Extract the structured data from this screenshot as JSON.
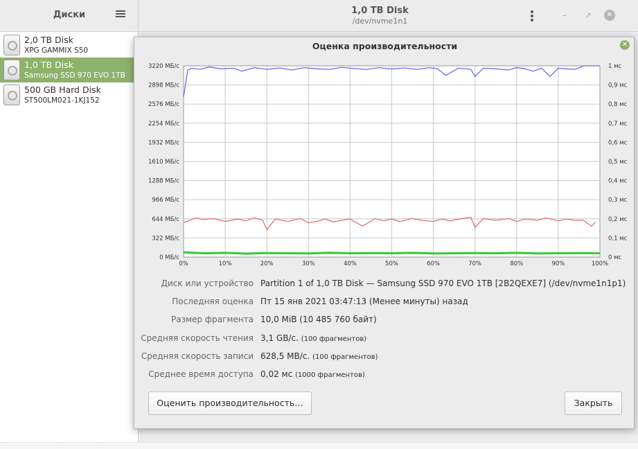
{
  "sidebar": {
    "title": "Диски",
    "items": [
      {
        "name": "2,0 TB Disk",
        "model": "XPG GAMMIX S50"
      },
      {
        "name": "1,0 TB Disk",
        "model": "Samsung SSD 970 EVO 1TB"
      },
      {
        "name": "500 GB Hard Disk",
        "model": "ST500LM021-1KJ152"
      }
    ],
    "selected_index": 1
  },
  "header": {
    "title": "1,0 TB Disk",
    "subtitle": "/dev/nvme1n1",
    "minimize_glyph": "–",
    "maximize_glyph": "↗",
    "close_glyph": "✕"
  },
  "dialog": {
    "title": "Оценка производительности",
    "close_glyph": "✕",
    "info": [
      {
        "label": "Диск или устройство",
        "value": "Partition 1 of 1,0 TB Disk — Samsung SSD 970 EVO 1TB [2B2QEXE7] (/dev/nvme1n1p1)",
        "extra": ""
      },
      {
        "label": "Последняя оценка",
        "value": "Пт 15 янв 2021 03:47:13 (Менее минуты) назад",
        "extra": ""
      },
      {
        "label": "Размер фрагмента",
        "value": "10,0 MiB (10 485 760 байт)",
        "extra": ""
      },
      {
        "label": "Средняя скорость чтения",
        "value": "3,1 GB/с.",
        "extra": "(100 фрагментов)"
      },
      {
        "label": "Средняя скорость записи",
        "value": "628,5 MB/с.",
        "extra": "(100 фрагментов)"
      },
      {
        "label": "Среднее время доступа",
        "value": "0,02 мс",
        "extra": "(1000 фрагментов)"
      }
    ],
    "buttons": {
      "benchmark": "Оценить производительность…",
      "close": "Закрыть"
    }
  },
  "chart_data": {
    "type": "line",
    "left_axis_ticks": [
      "3220 МБ/с",
      "2898 МБ/с",
      "2576 МБ/с",
      "2254 МБ/с",
      "1932 МБ/с",
      "1610 МБ/с",
      "1288 МБ/с",
      "966 МБ/с",
      "644 МБ/с",
      "322 МБ/с",
      "0 МБ/с"
    ],
    "right_axis_ticks": [
      "1 мс",
      "0,9 мс",
      "0,8 мс",
      "0,7 мс",
      "0,6 мс",
      "0,5 мс",
      "0,4 мс",
      "0,3 мс",
      "0,2 мс",
      "0,1 мс",
      "0 мс"
    ],
    "x_ticks": [
      "0%",
      "10%",
      "20%",
      "30%",
      "40%",
      "50%",
      "60%",
      "70%",
      "80%",
      "90%",
      "100%"
    ],
    "ylim_left": [
      0,
      3220
    ],
    "ylim_right": [
      0,
      1
    ],
    "xlim": [
      0,
      100
    ],
    "grid": true,
    "series": [
      {
        "color": "#6b6bf0",
        "axis": "left",
        "x": [
          0,
          1,
          2,
          4,
          6,
          9,
          12,
          14,
          17,
          20,
          23,
          26,
          29,
          32,
          35,
          38,
          41,
          44,
          47,
          50,
          53,
          56,
          59,
          61,
          63,
          66,
          69,
          70,
          72,
          75,
          78,
          80,
          82,
          84,
          86,
          88,
          90,
          92,
          94,
          95,
          96,
          98,
          100
        ],
        "y": [
          2700,
          3150,
          3180,
          3160,
          3200,
          3170,
          3180,
          3130,
          3190,
          3160,
          3185,
          3150,
          3190,
          3170,
          3160,
          3195,
          3175,
          3160,
          3190,
          3165,
          3185,
          3160,
          3190,
          3170,
          3060,
          3180,
          3160,
          3040,
          3180,
          3170,
          3150,
          3190,
          3170,
          3130,
          3180,
          3040,
          3180,
          3170,
          3160,
          3185,
          3220,
          3220,
          3220
        ]
      },
      {
        "color": "#e07070",
        "axis": "left",
        "x": [
          0,
          3,
          5,
          7,
          10,
          13,
          15,
          17,
          19,
          20,
          22,
          25,
          28,
          30,
          32,
          34,
          36,
          38,
          40,
          43,
          46,
          48,
          50,
          52,
          55,
          57,
          60,
          62,
          64,
          67,
          69,
          70,
          72,
          75,
          78,
          80,
          82,
          85,
          87,
          90,
          92,
          94,
          96,
          98,
          99
        ],
        "y": [
          580,
          660,
          630,
          650,
          600,
          640,
          610,
          660,
          620,
          460,
          640,
          600,
          650,
          580,
          600,
          640,
          590,
          620,
          640,
          520,
          650,
          610,
          640,
          600,
          650,
          620,
          600,
          640,
          610,
          650,
          670,
          500,
          650,
          620,
          650,
          600,
          640,
          620,
          660,
          610,
          640,
          620,
          620,
          520,
          590
        ]
      },
      {
        "color": "#33cc33",
        "axis": "right",
        "x": [
          0,
          5,
          10,
          15,
          20,
          25,
          30,
          35,
          40,
          45,
          50,
          55,
          60,
          65,
          70,
          75,
          80,
          85,
          90,
          95,
          100
        ],
        "y": [
          0.025,
          0.02,
          0.022,
          0.018,
          0.021,
          0.02,
          0.019,
          0.023,
          0.02,
          0.021,
          0.02,
          0.022,
          0.019,
          0.02,
          0.021,
          0.02,
          0.022,
          0.019,
          0.02,
          0.021,
          0.02
        ]
      }
    ]
  }
}
